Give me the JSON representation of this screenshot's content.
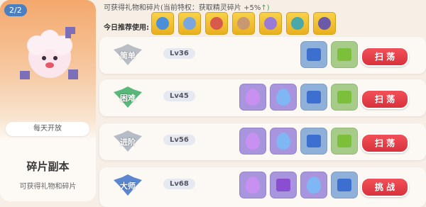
{
  "left_panel": {
    "page_indicator": "2/2",
    "open_status": "每天开放",
    "title": "碎片副本",
    "subtitle": "可获得礼物和碎片"
  },
  "header": {
    "rewards_text": "可获得礼物和碎片(当前特权：获取精灵碎片 +5%",
    "bonus_arrow": "↑)",
    "recommend_label": "今日推荐使用:",
    "recommended": [
      {
        "icon": "creature-scroll-icon",
        "color": "#4a8fd8"
      },
      {
        "icon": "creature-bird-icon",
        "color": "#7aa6e0"
      },
      {
        "icon": "creature-egg-icon",
        "color": "#d85a4a"
      },
      {
        "icon": "creature-bear-icon",
        "color": "#c89870"
      },
      {
        "icon": "creature-star-icon",
        "color": "#9a7ad8"
      },
      {
        "icon": "creature-fish-icon",
        "color": "#4aa8a8"
      },
      {
        "icon": "creature-horn-icon",
        "color": "#6a5aa8"
      }
    ]
  },
  "stages": [
    {
      "difficulty": "简单",
      "level": "Lv36",
      "action": "扫 荡",
      "emblem_color": "#b9bec6",
      "rewards": [
        "blue-box",
        "green-box"
      ]
    },
    {
      "difficulty": "困难",
      "level": "Lv45",
      "action": "扫 荡",
      "emblem_color": "#58b87a",
      "rewards": [
        "purple-drop",
        "blue-drop",
        "blue-box",
        "green-box"
      ]
    },
    {
      "difficulty": "进阶",
      "level": "Lv56",
      "action": "扫 荡",
      "emblem_color": "#b5bcc8",
      "rewards": [
        "purple-drop",
        "blue-drop",
        "blue-box",
        "green-box"
      ]
    },
    {
      "difficulty": "大师",
      "level": "Lv68",
      "action": "挑 战",
      "emblem_color": "#5b86d0",
      "rewards": [
        "purple-drop",
        "purple-box",
        "blue-drop",
        "blue-box"
      ]
    }
  ]
}
